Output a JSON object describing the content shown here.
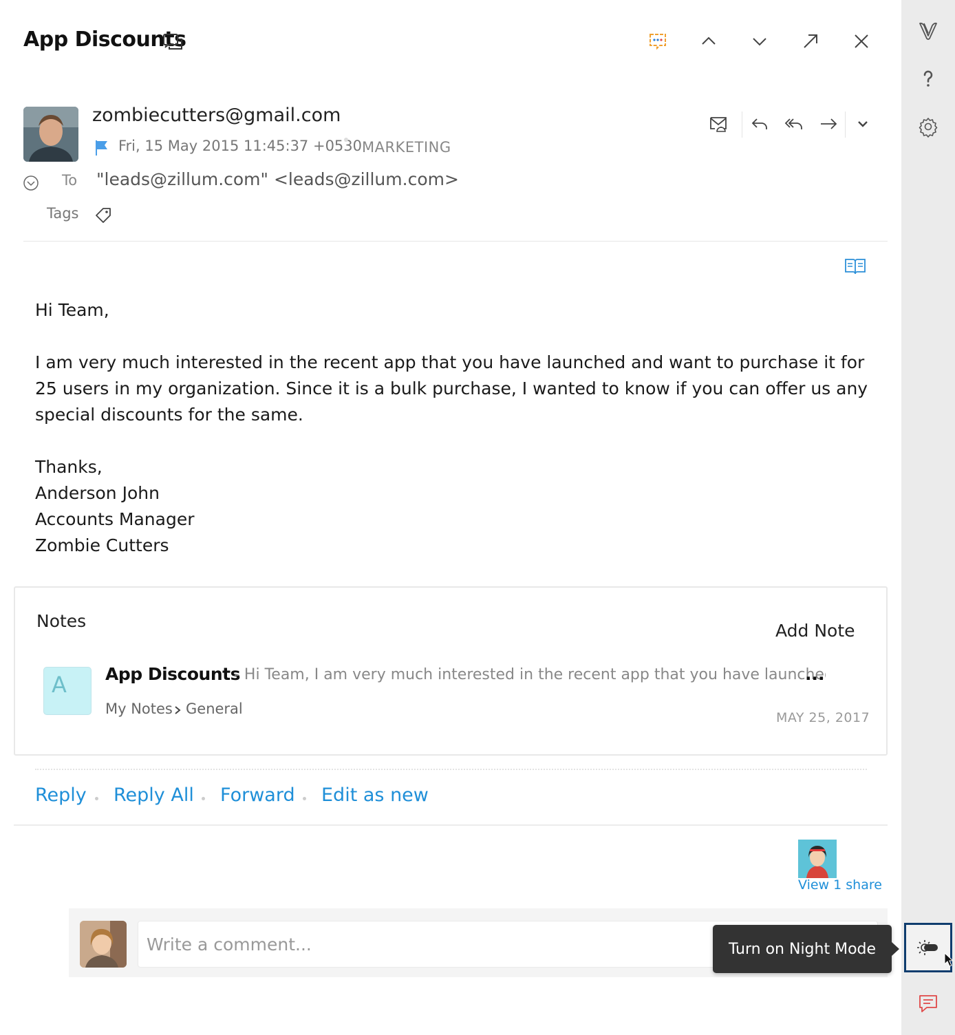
{
  "header": {
    "subject": "App Discounts",
    "icons": [
      "conversation-icon",
      "chat-icon",
      "chevron-up-icon",
      "chevron-down-icon",
      "expand-arrow-icon",
      "close-icon"
    ]
  },
  "sender": {
    "email": "zombiecutters@gmail.com",
    "date": "Fri, 15 May 2015 11:45:37 +0530",
    "folder": "MARKETING",
    "to_label": "To",
    "to_value": "\"leads@zillum.com\" <leads@zillum.com>",
    "tags_label": "Tags"
  },
  "body": {
    "greeting": "Hi Team,",
    "paragraph": "I am very much interested in the recent app that you have launched and want to purchase it for 25 users in my organization. Since it is a bulk purchase, I wanted to know if you can offer us any special discounts for the same.",
    "signature": [
      "Thanks,",
      "Anderson John",
      "Accounts Manager",
      "Zombie Cutters"
    ]
  },
  "notes": {
    "title": "Notes",
    "add_label": "Add Note",
    "item": {
      "avatar_letter": "A",
      "title": "App Discounts",
      "snippet": "- Hi Team, I am very much interested in the recent app that you have launched a",
      "ellipsis": "...",
      "path_root": "My Notes",
      "path_folder": "General",
      "date": "MAY 25, 2017"
    }
  },
  "actions": {
    "reply": "Reply",
    "reply_all": "Reply All",
    "forward": "Forward",
    "edit_as_new": "Edit as new"
  },
  "share": {
    "label": "View 1 share"
  },
  "comment": {
    "placeholder": "Write a comment..."
  },
  "tooltip": {
    "text": "Turn on Night Mode"
  },
  "colors": {
    "link": "#1f8fd8",
    "flag": "#4a9ee8",
    "rail_bg": "#ebebeb",
    "night_border": "#0f3d6e",
    "comment_icon": "#e04848"
  }
}
